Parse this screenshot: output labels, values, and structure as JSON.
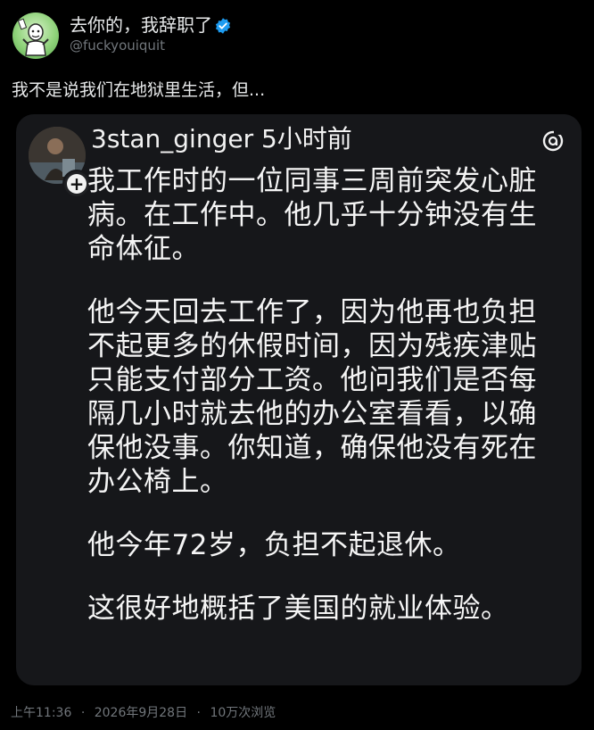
{
  "tweet": {
    "display_name": "去你的，我辞职了",
    "handle": "@fuckyouiquit",
    "text": "我不是说我们在地狱里生活，但...",
    "verified_color": "#1d9bf0"
  },
  "embed": {
    "username": "3stan_ginger 5小时前",
    "paragraphs": [
      "我工作时的一位同事三周前突发心脏病。在工作中。他几乎十分钟没有生命体征。",
      "他今天回去工作了，因为他再也负担不起更多的休假时间，因为残疾津贴只能支付部分工资。他问我们是否每隔几小时就去他的办公室看看，以确保他没事。你知道，确保他没有死在办公椅上。",
      "他今年72岁，负担不起退休。",
      "这很好地概括了美国的就业体验。"
    ],
    "icons": [
      "plus-icon",
      "threads-logo-icon"
    ]
  },
  "footer": {
    "time": "上午11:36",
    "date": "2026年9月28日",
    "views": "10万次浏览"
  }
}
